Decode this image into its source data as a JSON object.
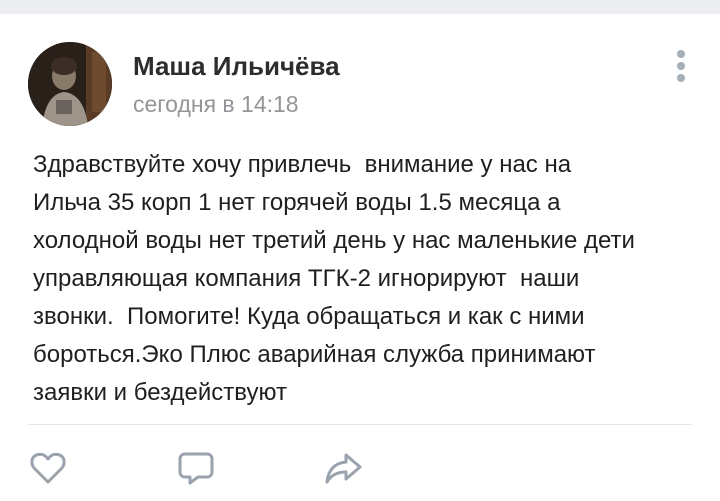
{
  "post": {
    "author": "Маша Ильичёва",
    "time": "сегодня в 14:18",
    "text": "Здравствуйте хочу привлечь  внимание у нас на\nИльча 35 корп 1 нет горячей воды 1.5 месяца а\nхолодной воды нет третий день у нас маленькие дети\nуправляющая компания ТГК-2 игнорируют  наши\nзвонки.  Помогите! Куда обращаться и как с ними\nбороться.Эко Плюс аварийная служба принимают\nзаявки и бездействуют"
  },
  "icons": {
    "more": "more-vertical-icon",
    "like": "heart-icon",
    "comment": "comment-icon",
    "share": "share-icon"
  },
  "colors": {
    "background": "#ffffff",
    "top_band": "#ebedf0",
    "name": "#2c2d2e",
    "secondary": "#939598",
    "icon": "#99a2ad",
    "text": "#1f1f1f"
  }
}
